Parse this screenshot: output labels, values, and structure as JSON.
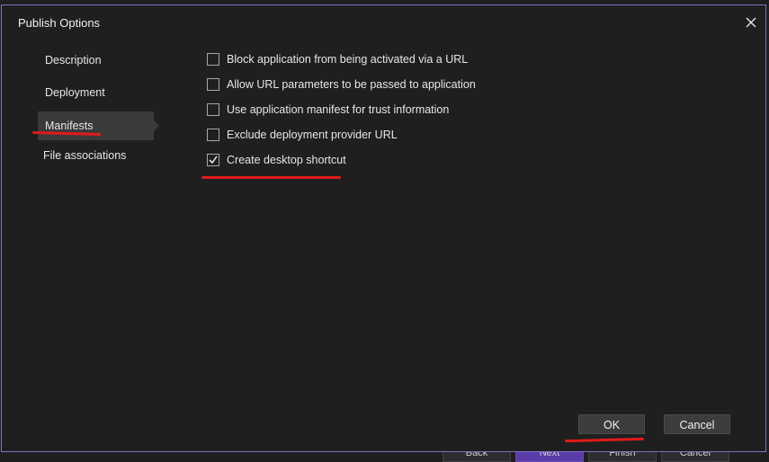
{
  "dialog": {
    "title": "Publish Options"
  },
  "nav": {
    "items": [
      {
        "label": "Description",
        "selected": false
      },
      {
        "label": "Deployment",
        "selected": false
      },
      {
        "label": "Manifests",
        "selected": true
      },
      {
        "label": "File associations",
        "selected": false
      }
    ]
  },
  "options": [
    {
      "label": "Block application from being activated via a URL",
      "checked": false
    },
    {
      "label": "Allow URL parameters to be passed to application",
      "checked": false
    },
    {
      "label": "Use application manifest for trust information",
      "checked": false
    },
    {
      "label": "Exclude deployment provider URL",
      "checked": false
    },
    {
      "label": "Create desktop shortcut",
      "checked": true
    }
  ],
  "buttons": {
    "ok": "OK",
    "cancel": "Cancel"
  },
  "background_wizard": {
    "back": "Back",
    "next": "Next",
    "finish": "Finish",
    "cancel": "Cancel"
  },
  "colors": {
    "background": "#1f1f1f",
    "border": "#7b73c8",
    "annotation": "#e01b1b",
    "selected_nav": "#3a3a3a"
  }
}
